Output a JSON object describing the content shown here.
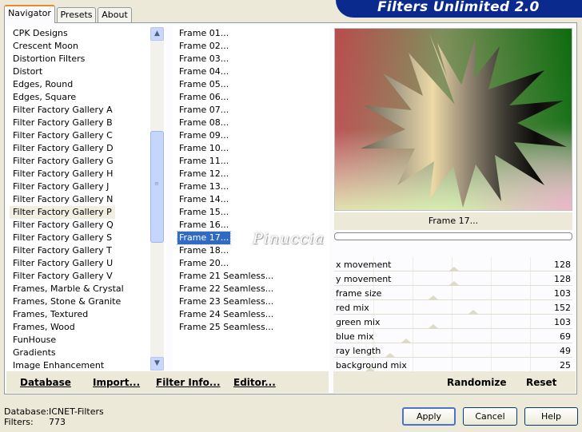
{
  "header": {
    "title": "Filters Unlimited 2.0"
  },
  "tabs": [
    {
      "label": "Navigator",
      "active": true
    },
    {
      "label": "Presets",
      "active": false
    },
    {
      "label": "About",
      "active": false
    }
  ],
  "categories": [
    "CPK Designs",
    "Crescent Moon",
    "Distortion Filters",
    "Distort",
    "Edges, Round",
    "Edges, Square",
    "Filter Factory Gallery A",
    "Filter Factory Gallery B",
    "Filter Factory Gallery C",
    "Filter Factory Gallery D",
    "Filter Factory Gallery G",
    "Filter Factory Gallery H",
    "Filter Factory Gallery J",
    "Filter Factory Gallery N",
    "Filter Factory Gallery P",
    "Filter Factory Gallery Q",
    "Filter Factory Gallery S",
    "Filter Factory Gallery T",
    "Filter Factory Gallery U",
    "Filter Factory Gallery V",
    "Frames, Marble & Crystal",
    "Frames, Stone & Granite",
    "Frames, Textured",
    "Frames, Wood",
    "FunHouse",
    "Gradients",
    "Image Enhancement"
  ],
  "selected_category": "Filter Factory Gallery P",
  "filters": [
    "Frame 01...",
    "Frame 02...",
    "Frame 03...",
    "Frame 04...",
    "Frame 05...",
    "Frame 06...",
    "Frame 07...",
    "Frame 08...",
    "Frame 09...",
    "Frame 10...",
    "Frame 11...",
    "Frame 12...",
    "Frame 13...",
    "Frame 14...",
    "Frame 15...",
    "Frame 16...",
    "Frame 17...",
    "Frame 18...",
    "Frame 20...",
    "Frame 21 Seamless...",
    "Frame 22 Seamless...",
    "Frame 23 Seamless...",
    "Frame 24 Seamless...",
    "Frame 25 Seamless..."
  ],
  "selected_filter": "Frame 17...",
  "preview": {
    "label": "Frame 17..."
  },
  "watermark": "Pinuccia",
  "sliders": [
    {
      "label": "x movement",
      "value": "128",
      "level": 128
    },
    {
      "label": "y movement",
      "value": "128",
      "level": 128
    },
    {
      "label": "frame size",
      "value": "103",
      "level": 103
    },
    {
      "label": "red mix",
      "value": "152",
      "level": 152
    },
    {
      "label": "green mix",
      "value": "103",
      "level": 103
    },
    {
      "label": "blue mix",
      "value": "69",
      "level": 69
    },
    {
      "label": "ray length",
      "value": "49",
      "level": 49
    },
    {
      "label": "background mix",
      "value": "25",
      "level": 25
    }
  ],
  "left_buttons": {
    "database": "Database",
    "import": "Import...",
    "filter_info": "Filter Info...",
    "editor": "Editor..."
  },
  "right_buttons": {
    "randomize": "Randomize",
    "reset": "Reset"
  },
  "footer": {
    "database_label": "Database:",
    "database_value": "ICNET-Filters",
    "filters_label": "Filters:",
    "filters_value": "773"
  },
  "dialog_buttons": {
    "apply": "Apply",
    "cancel": "Cancel",
    "help": "Help"
  }
}
